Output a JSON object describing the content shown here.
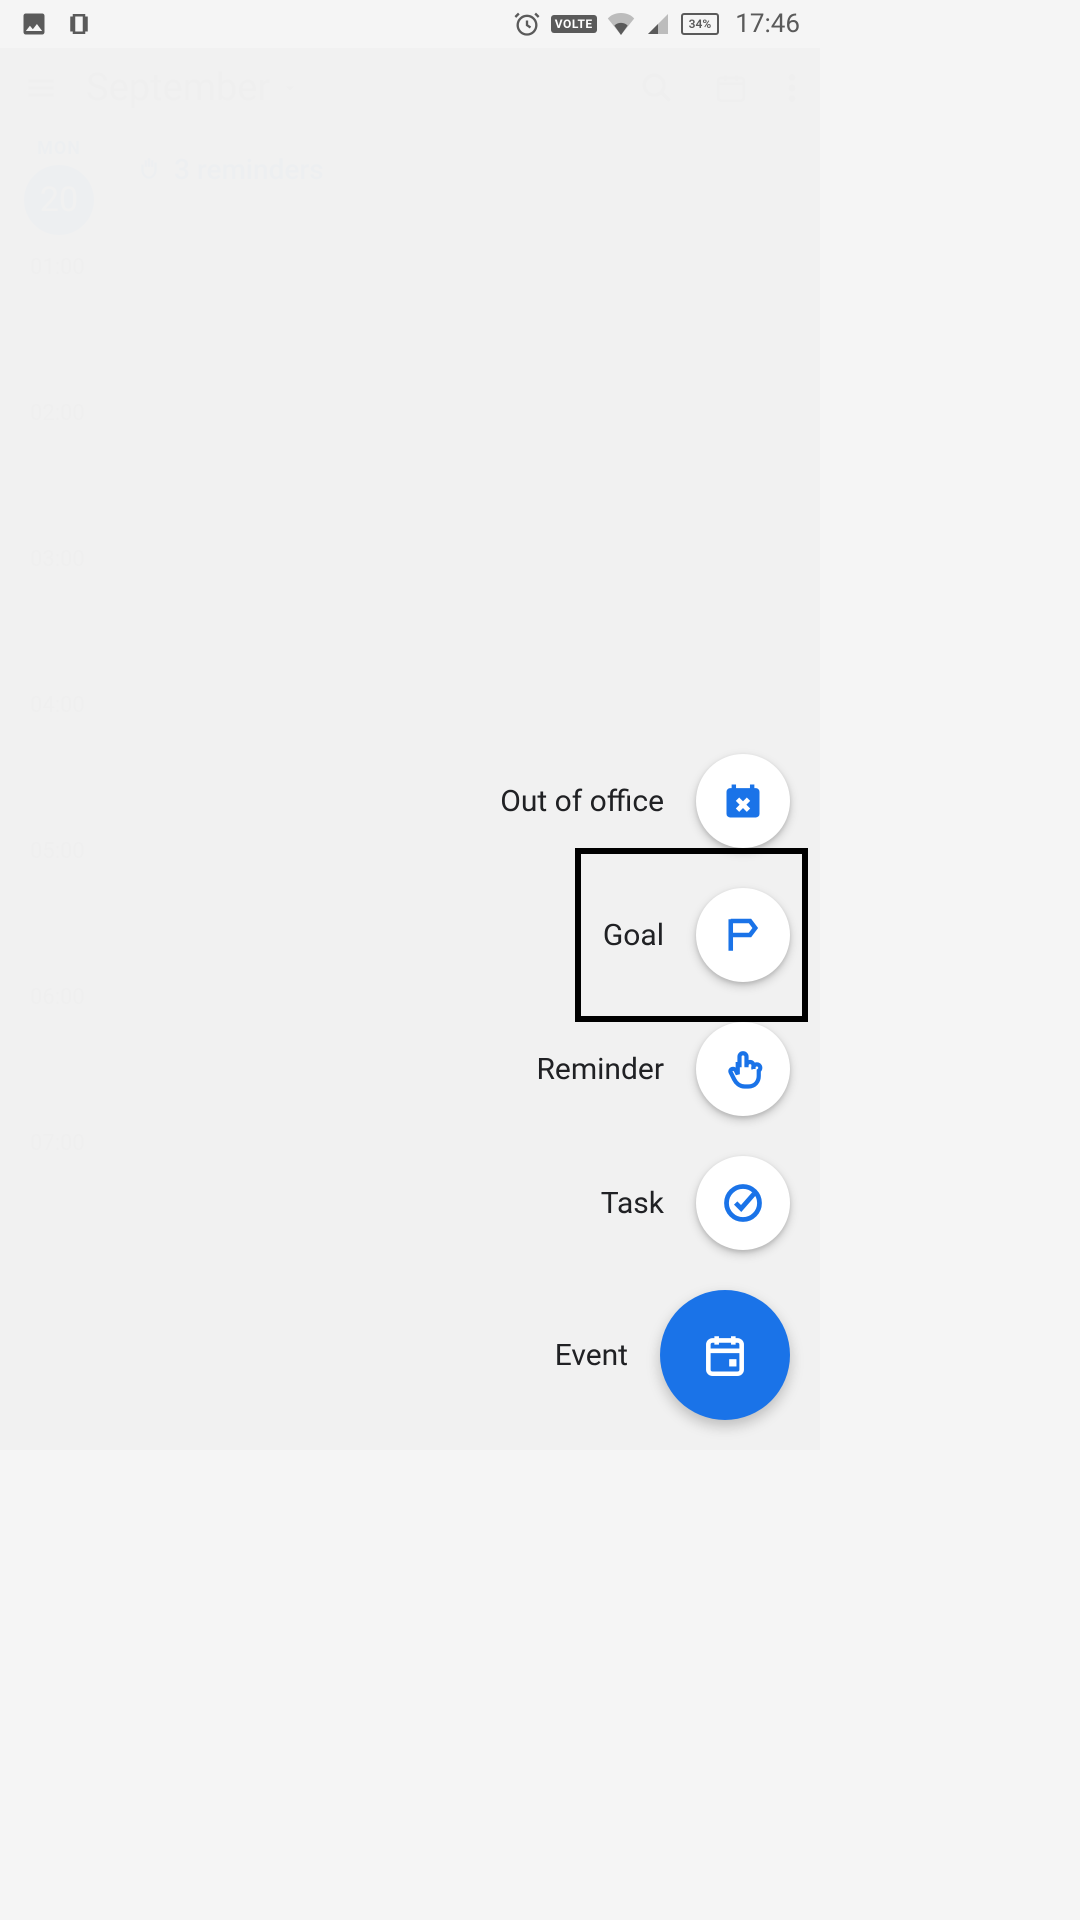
{
  "status": {
    "time": "17:46",
    "battery": "34%",
    "volte": "VOLTE"
  },
  "app": {
    "title": "September"
  },
  "day": {
    "label": "MON",
    "number": "20",
    "reminder_banner": "3 reminders"
  },
  "time_slots": [
    "01:00",
    "02:00",
    "03:00",
    "04:00",
    "05:00",
    "06:00",
    "07:00"
  ],
  "fab": {
    "items": [
      {
        "label": "Out of office",
        "icon": "calendar-x"
      },
      {
        "label": "Goal",
        "icon": "flag",
        "highlighted": true
      },
      {
        "label": "Reminder",
        "icon": "hand-tap"
      },
      {
        "label": "Task",
        "icon": "check-circle"
      }
    ],
    "main": {
      "label": "Event",
      "icon": "calendar-day"
    }
  }
}
